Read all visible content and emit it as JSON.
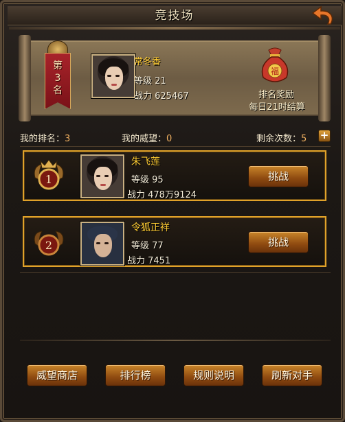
{
  "header": {
    "title": "竞技场"
  },
  "me": {
    "rank_text": [
      "第",
      "3",
      "名"
    ],
    "name": "常冬香",
    "level": "等级 21",
    "power": "战力 625467"
  },
  "reward": {
    "title": "排名奖励",
    "time": "每日21时结算",
    "bag_glyph": "福"
  },
  "stats": {
    "my_rank_label": "我的排名：",
    "my_rank_value": "3",
    "prestige_label": "我的威望：",
    "prestige_value": "0",
    "remaining_label": "剩余次数：",
    "remaining_value": "5",
    "plus": "+"
  },
  "opponents": [
    {
      "medal": "1",
      "name": "朱飞莲",
      "level": "等级 95",
      "power": "战力  478万9124",
      "button": "挑战"
    },
    {
      "medal": "2",
      "name": "令狐正祥",
      "level": "等级 77",
      "power": "战力  7451",
      "button": "挑战"
    }
  ],
  "buttons": [
    "威望商店",
    "排行榜",
    "规则说明",
    "刷新对手"
  ],
  "colors": {
    "gold": "#ffcc33",
    "border": "#e0a22a",
    "button": "#8e4a10"
  }
}
